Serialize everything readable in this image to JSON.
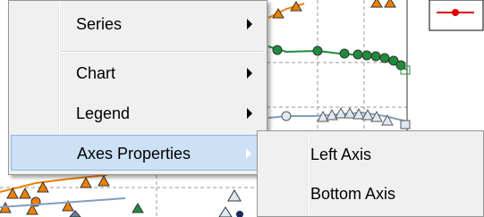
{
  "context_menu": {
    "items": [
      {
        "label": "Series",
        "has_submenu": true
      },
      {
        "label": "Chart",
        "has_submenu": true
      },
      {
        "label": "Legend",
        "has_submenu": true
      },
      {
        "label": "Axes Properties",
        "has_submenu": true,
        "highlighted": true
      }
    ]
  },
  "submenu": {
    "items": [
      {
        "label": "Left Axis"
      },
      {
        "label": "Bottom Axis"
      }
    ]
  },
  "colors": {
    "menu_bg": "#f0f0f0",
    "highlight_bg": "#cce1f6",
    "series_orange": "#f08000",
    "series_green": "#1e8c3c",
    "series_blue": "#7f9fbf",
    "series_red": "#e00000"
  }
}
